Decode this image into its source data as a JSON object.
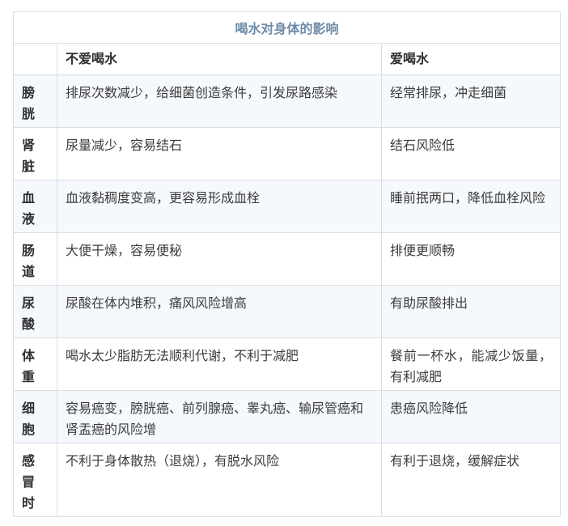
{
  "table": {
    "title": "喝水对身体的影响",
    "columns": [
      "",
      "不爱喝水",
      "爱喝水"
    ],
    "rows": [
      {
        "label": "膀胱",
        "not_drink": "排尿次数减少，给细菌创造条件，引发尿路感染",
        "drink": "经常排尿，冲走细菌"
      },
      {
        "label": "肾脏",
        "not_drink": "尿量减少，容易结石",
        "drink": "结石风险低"
      },
      {
        "label": "血液",
        "not_drink": "血液黏稠度变高，更容易形成血栓",
        "drink": "睡前抿两口，降低血栓风险"
      },
      {
        "label": "肠道",
        "not_drink": "大便干燥，容易便秘",
        "drink": "排便更顺畅"
      },
      {
        "label": "尿酸",
        "not_drink": "尿酸在体内堆积，痛风风险增高",
        "drink": "有助尿酸排出"
      },
      {
        "label": "体重",
        "not_drink": "喝水太少脂肪无法顺利代谢，不利于减肥",
        "drink": "餐前一杯水，能减少饭量，有利减肥"
      },
      {
        "label": "细胞",
        "not_drink": "容易癌变，膀胱癌、前列腺癌、睾丸癌、输尿管癌和肾盂癌的风险增",
        "drink": "患癌风险降低"
      },
      {
        "label": "感冒时",
        "not_drink": "不利于身体散热（退烧），有脱水风险",
        "drink": "有利于退烧，缓解症状"
      }
    ]
  }
}
